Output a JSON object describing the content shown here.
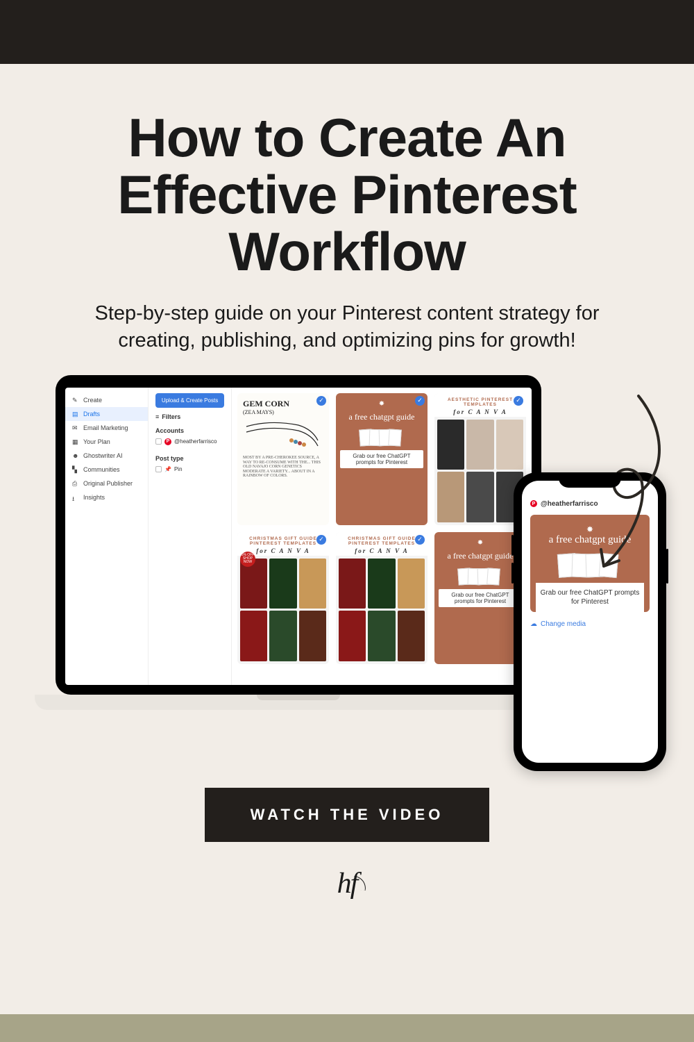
{
  "title": "How to Create An Effective Pinterest Workflow",
  "subtitle": "Step-by-step guide on your Pinterest content strategy for creating, publishing, and optimizing pins for growth!",
  "cta_label": "WATCH THE VIDEO",
  "logo_text": "hf",
  "laptop": {
    "sidebar": {
      "items": [
        {
          "icon": "pencil",
          "label": "Create"
        },
        {
          "icon": "drafts",
          "label": "Drafts",
          "active": true
        },
        {
          "icon": "mail",
          "label": "Email Marketing"
        },
        {
          "icon": "calendar",
          "label": "Your Plan"
        },
        {
          "icon": "ghost",
          "label": "Ghostwriter AI"
        },
        {
          "icon": "people",
          "label": "Communities"
        },
        {
          "icon": "publisher",
          "label": "Original Publisher"
        },
        {
          "icon": "chart",
          "label": "Insights"
        }
      ]
    },
    "upload_button": "Upload & Create Posts",
    "filters_label": "Filters",
    "accounts_label": "Accounts",
    "account_handle": "@heatherfarrisco",
    "posttype_label": "Post type",
    "posttype_value": "Pin",
    "cards": {
      "sketch": {
        "title": "GEM CORN",
        "subtitle": "(ZEA MAYS)",
        "body": "MOST BY A PRE-CHEROKEE SOURCE, A WAY TO RE-CONSUME WITH THE... THIS OLD NAVAJO CORN GENETICS MODERATE A VARIETY... ABOUT IN A RAINBOW OF COLORS."
      },
      "chatgpt": {
        "title": "a free chatgpt guide",
        "sub": "Grab our free ChatGPT prompts for Pinterest"
      },
      "aesthetic": {
        "strip": "AESTHETIC PINTEREST TEMPLATES",
        "canva": "for C A N V A"
      },
      "gift": {
        "strip": "CHRISTMAS GIFT GUIDE PINTEREST TEMPLATES",
        "canva": "for C A N V A",
        "badge": "5% OFF SHOP NOW"
      }
    }
  },
  "phone": {
    "account_handle": "@heatherfarrisco",
    "card_title": "a free chatgpt guide",
    "card_sub": "Grab our free ChatGPT prompts for Pinterest",
    "change_media": "Change media"
  }
}
